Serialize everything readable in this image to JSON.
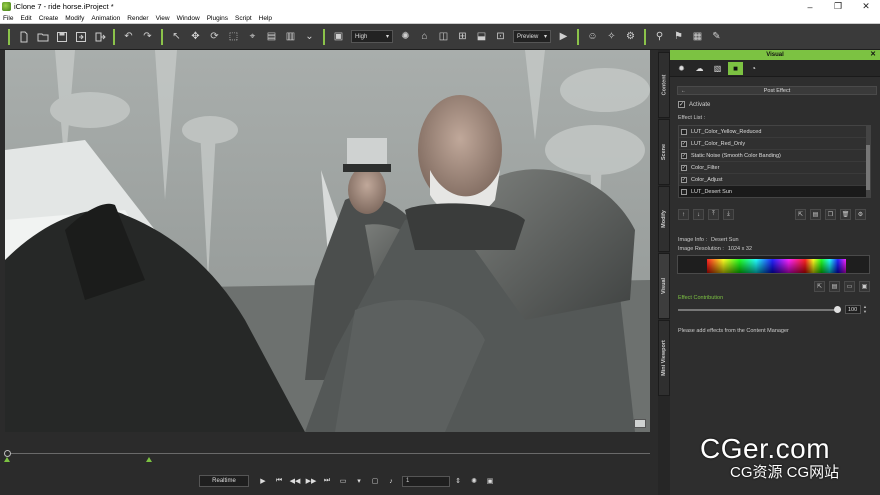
{
  "window": {
    "title": "iClone 7 - ride horse.iProject *"
  },
  "menu": [
    "File",
    "Edit",
    "Create",
    "Modify",
    "Animation",
    "Render",
    "View",
    "Window",
    "Plugins",
    "Script",
    "Help"
  ],
  "toolbar": {
    "quality": "High",
    "render_mode": "Preview"
  },
  "playback": {
    "mode": "Realtime",
    "frame": "1"
  },
  "side_tabs": [
    "Content",
    "Scene",
    "Modify",
    "Visual",
    "Mini Viewport"
  ],
  "panel": {
    "title": "Visual",
    "section": "Post Effect",
    "activate_label": "Activate",
    "effect_list_label": "Effect List :",
    "effects": [
      {
        "label": "LUT_Color_Yellow_Reduced",
        "checked": false
      },
      {
        "label": "LUT_Color_Red_Only",
        "checked": true
      },
      {
        "label": "Static Noise (Smooth Color Banding)",
        "checked": true
      },
      {
        "label": "Color_Filter",
        "checked": true
      },
      {
        "label": "Color_Adjust",
        "checked": true
      },
      {
        "label": "LUT_Desert Sun",
        "checked": false
      }
    ],
    "image_info_label": "Image Info :",
    "image_info_value": "Desert Sun",
    "image_resolution_label": "Image Resolution :",
    "image_resolution_value": "1024 x 32",
    "contribution_label": "Effect Contribution",
    "contribution_value": "100",
    "note": "Please add effects from the Content Manager"
  },
  "watermark": {
    "main": "CGer.com",
    "sub": "CG资源 CG网站"
  },
  "colors": {
    "accent": "#7cc242",
    "panel": "#2e2e2e",
    "background": "#2b2b2b"
  }
}
